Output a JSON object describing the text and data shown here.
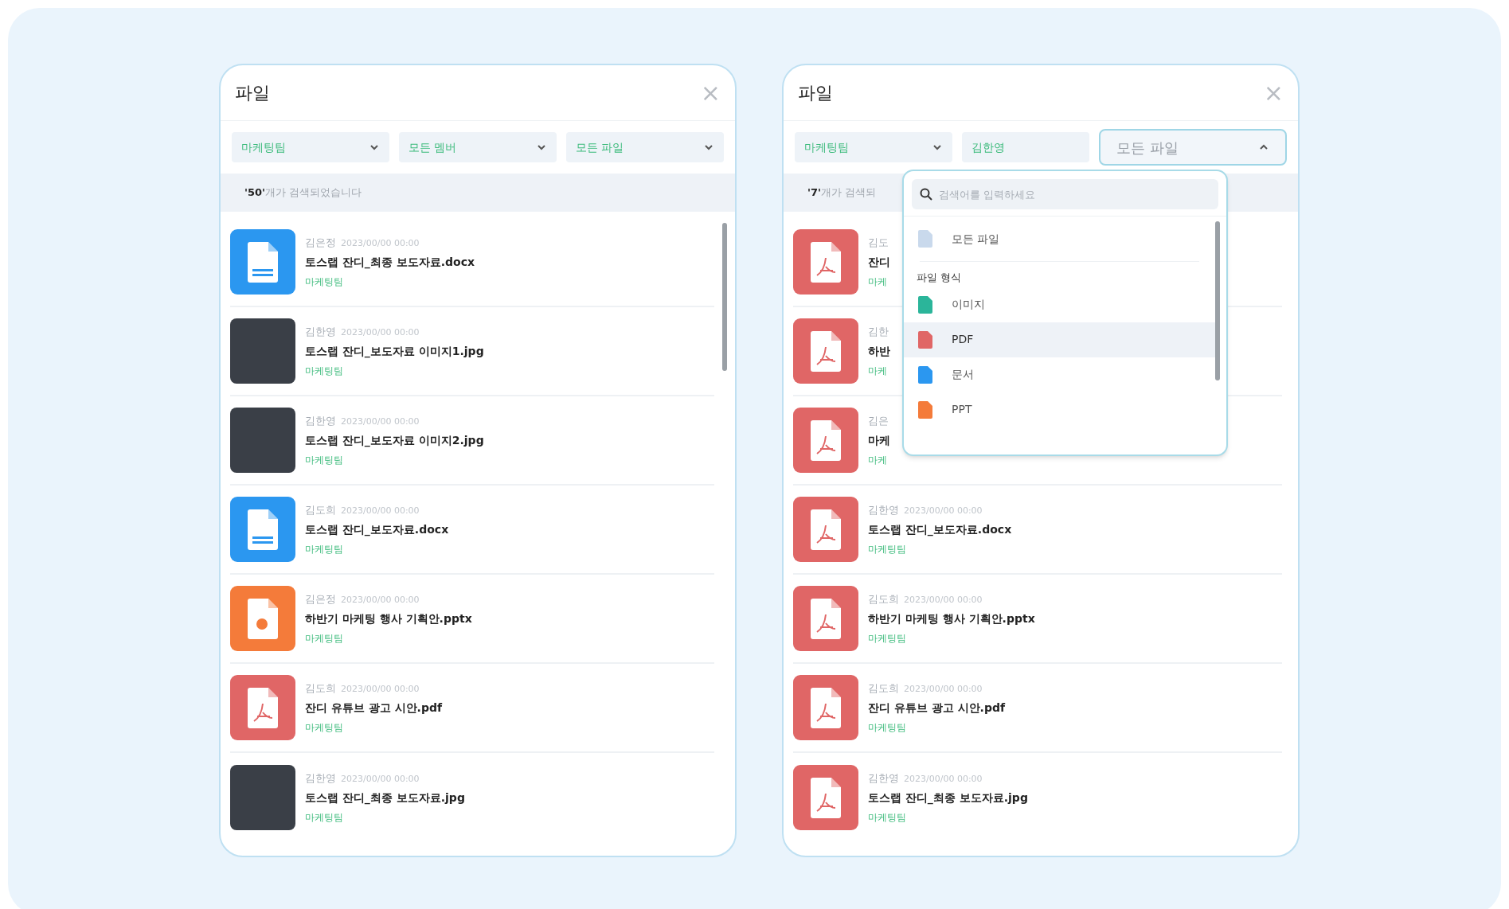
{
  "panels": [
    {
      "title": "파일",
      "close": "×",
      "filters": [
        {
          "label": "마케팅팀",
          "kind": "select",
          "open": false
        },
        {
          "label": "모든 멤버",
          "kind": "select",
          "open": false
        },
        {
          "label": "모든 파일",
          "kind": "select",
          "open": false
        }
      ],
      "count": {
        "number": "'50'",
        "text": "개가 검색되었습니다"
      },
      "scrollbar": true,
      "rows": [
        {
          "author": "김은정",
          "date": "2023/00/00 00:00",
          "title": "토스랩 잔디_최종 보도자료.docx",
          "tag": "마케팅팀",
          "kind": "doc"
        },
        {
          "author": "김한영",
          "date": "2023/00/00 00:00",
          "title": "토스랩 잔디_보도자료 이미지1.jpg",
          "tag": "마케팅팀",
          "kind": "photo"
        },
        {
          "author": "김한영",
          "date": "2023/00/00 00:00",
          "title": "토스랩 잔디_보도자료 이미지2.jpg",
          "tag": "마케팅팀",
          "kind": "photo"
        },
        {
          "author": "김도희",
          "date": "2023/00/00 00:00",
          "title": "토스랩 잔디_보도자료.docx",
          "tag": "마케팅팀",
          "kind": "doc"
        },
        {
          "author": "김은정",
          "date": "2023/00/00 00:00",
          "title": "하반기 마케팅 행사 기획안.pptx",
          "tag": "마케팅팀",
          "kind": "ppt"
        },
        {
          "author": "김도희",
          "date": "2023/00/00 00:00",
          "title": "잔디 유튜브 광고 시안.pdf",
          "tag": "마케팅팀",
          "kind": "pdf"
        },
        {
          "author": "김한영",
          "date": "2023/00/00 00:00",
          "title": "토스랩 잔디_최종 보도자료.jpg",
          "tag": "마케팅팀",
          "kind": "photo"
        }
      ]
    },
    {
      "title": "파일",
      "close": "×",
      "filters": [
        {
          "label": "마케팅팀",
          "kind": "select",
          "open": false
        },
        {
          "label": "김한영",
          "kind": "plain",
          "open": false
        },
        {
          "label": "모든 파일",
          "kind": "select",
          "open": true
        }
      ],
      "count": {
        "number": "'7'",
        "text": "개가 검색되"
      },
      "scrollbar": false,
      "rows": [
        {
          "author": "김도",
          "title": "잔디",
          "tag": "마케",
          "kind": "pdf"
        },
        {
          "author": "김한",
          "title": "하반",
          "tag": "마케",
          "kind": "pdf"
        },
        {
          "author": "김은",
          "title": "마케",
          "tag": "마케",
          "kind": "pdf"
        },
        {
          "author": "김한영",
          "date": "2023/00/00 00:00",
          "title": "토스랩 잔디_보도자료.docx",
          "tag": "마케팅팀",
          "kind": "pdf"
        },
        {
          "author": "김도희",
          "date": "2023/00/00 00:00",
          "title": "하반기 마케팅 행사 기획안.pptx",
          "tag": "마케팅팀",
          "kind": "pdf"
        },
        {
          "author": "김도희",
          "date": "2023/00/00 00:00",
          "title": "잔디 유튜브 광고 시안.pdf",
          "tag": "마케팅팀",
          "kind": "pdf"
        },
        {
          "author": "김한영",
          "date": "2023/00/00 00:00",
          "title": "토스랩 잔디_최종 보도자료.jpg",
          "tag": "마케팅팀",
          "kind": "pdf"
        }
      ],
      "dropdown": {
        "placeholder": "검색어를 입력하세요",
        "items": [
          {
            "kind": "option",
            "label": "모든 파일",
            "color": "#c9d9ec",
            "selected": false
          },
          {
            "kind": "header",
            "label": "파일 형식"
          },
          {
            "kind": "option",
            "label": "이미지",
            "color": "#2bb59a",
            "selected": false
          },
          {
            "kind": "option",
            "label": "PDF",
            "color": "#e06666",
            "selected": true
          },
          {
            "kind": "option",
            "label": "문서",
            "color": "#2b97f0",
            "selected": false
          },
          {
            "kind": "option",
            "label": "PPT",
            "color": "#f47b3a",
            "selected": false
          }
        ]
      }
    }
  ]
}
